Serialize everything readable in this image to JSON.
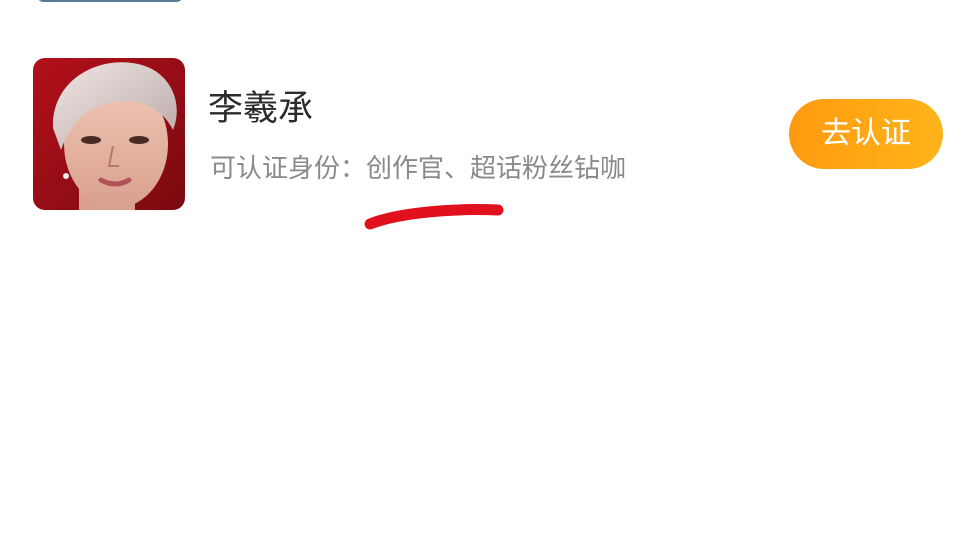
{
  "card": {
    "name": "李羲承",
    "identity_text": "可认证身份：创作官、超话粉丝钻咖",
    "action_label": "去认证"
  },
  "colors": {
    "accent": "#ffa417",
    "name_text": "#2b2b2b",
    "secondary_text": "#8a8a8a",
    "annotation": "#e0101c"
  },
  "icons": {
    "avatar": "user-photo"
  }
}
